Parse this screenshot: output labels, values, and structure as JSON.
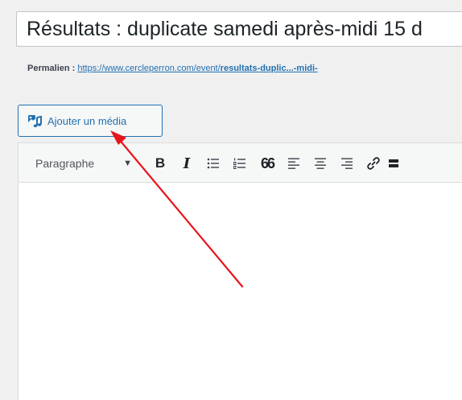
{
  "post": {
    "title": "Résultats : duplicate samedi après-midi 15 d"
  },
  "permalink": {
    "label": "Permalien :",
    "url_prefix": "https://www.cercleperron.com/event/",
    "url_slug": "resultats-duplic...-midi-"
  },
  "media_button": {
    "label": "Ajouter un média",
    "icon": "add-media-icon"
  },
  "toolbar": {
    "format_select": "Paragraphe",
    "bold_label": "B",
    "italic_label": "I",
    "quote_label": "66",
    "icons": [
      "bold-icon",
      "italic-icon",
      "bulleted-list-icon",
      "numbered-list-icon",
      "blockquote-icon",
      "align-left-icon",
      "align-center-icon",
      "align-right-icon",
      "link-icon",
      "toolbar-toggle-icon"
    ]
  },
  "annotation": {
    "arrow_color": "#e8141b"
  }
}
